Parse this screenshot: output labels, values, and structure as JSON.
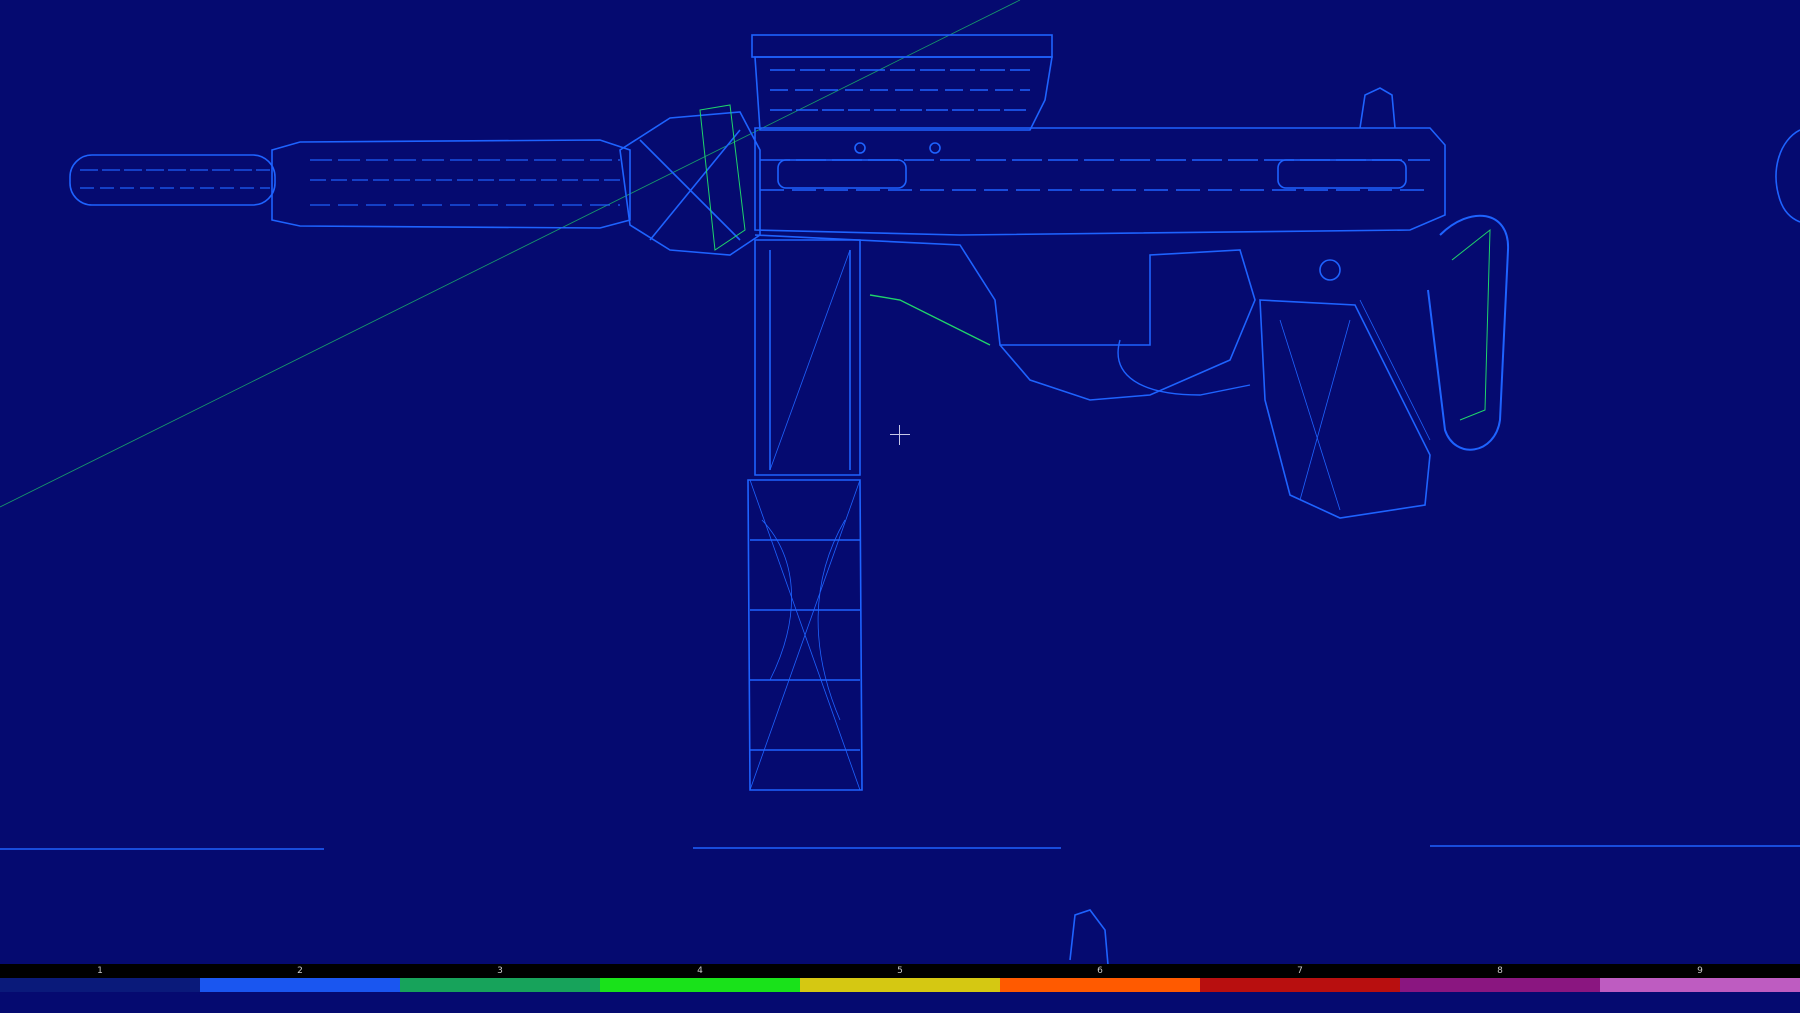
{
  "viewport": {
    "background": "#050a70",
    "wire_primary": "#1e63ff",
    "wire_secondary": "#1fd36b",
    "crosshair_color": "#c7c7e6"
  },
  "palette": {
    "slots": [
      {
        "label": "1",
        "color": "#0a1a7a"
      },
      {
        "label": "2",
        "color": "#1a56f0"
      },
      {
        "label": "3",
        "color": "#17a35b"
      },
      {
        "label": "4",
        "color": "#19e21a"
      },
      {
        "label": "5",
        "color": "#d5c812"
      },
      {
        "label": "6",
        "color": "#ff5a00"
      },
      {
        "label": "7",
        "color": "#b80f0f"
      },
      {
        "label": "8",
        "color": "#8a1680"
      },
      {
        "label": "9",
        "color": "#be5cc1"
      }
    ]
  }
}
